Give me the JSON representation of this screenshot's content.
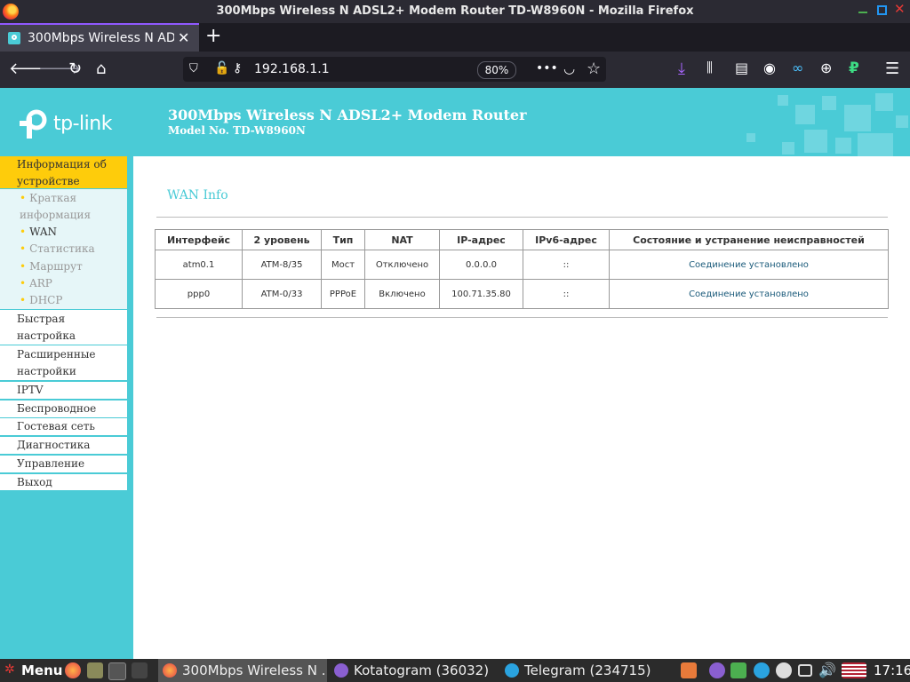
{
  "window": {
    "title": "300Mbps Wireless N ADSL2+ Modem Router TD-W8960N - Mozilla Firefox"
  },
  "tabs": [
    {
      "label": "300Mbps Wireless N ADSL2+ Modem Router TD-W8960N",
      "close": "✕"
    }
  ],
  "newtab": "+",
  "nav": {
    "url": "192.168.1.1",
    "zoom": "80%",
    "more": "•••"
  },
  "header": {
    "logo": "tp-link",
    "title": "300Mbps Wireless N ADSL2+ Modem Router",
    "model": "Model No. TD-W8960N"
  },
  "sidebar": {
    "active": "Информация об устройстве",
    "sub": [
      "Краткая информация",
      "WAN",
      "Статистика",
      "Маршрут",
      "ARP",
      "DHCP"
    ],
    "items": [
      "Быстрая настройка",
      "Расширенные настройки",
      "IPTV",
      "Беспроводное",
      "Гостевая сеть",
      "Диагностика",
      "Управление",
      "Выход"
    ]
  },
  "main": {
    "title": "WAN Info",
    "headers": [
      "Интерфейс",
      "2 уровень",
      "Тип",
      "NAT",
      "IP-адрес",
      "IPv6-адрес",
      "Состояние и устранение неисправностей"
    ],
    "rows": [
      [
        "atm0.1",
        "ATM-8/35",
        "Мост",
        "Отключено",
        "0.0.0.0",
        "::",
        "Соединение установлено"
      ],
      [
        "ppp0",
        "ATM-0/33",
        "PPPoE",
        "Включено",
        "100.71.35.80",
        "::",
        "Соединение установлено"
      ]
    ]
  },
  "taskbar": {
    "start": "Menu",
    "tasks": [
      "300Mbps Wireless N ...",
      "Kotatogram (36032)",
      "Telegram (234715)"
    ],
    "clock": "17:16"
  },
  "colors": {
    "accent": "#4acbd6",
    "active_menu": "#fecc0b",
    "firefox_dark": "#1c1b22",
    "toolbar": "#2b2a33"
  }
}
